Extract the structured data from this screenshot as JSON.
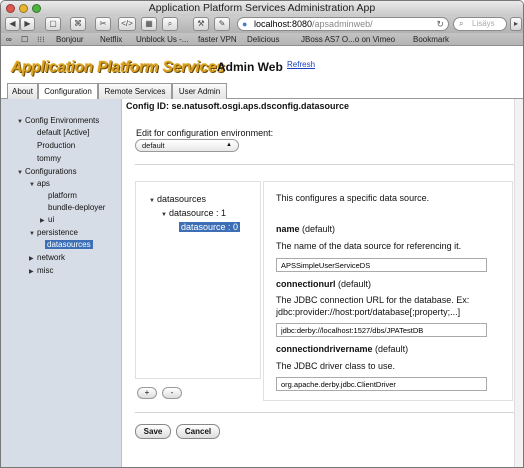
{
  "window": {
    "title": "Application Platform Services Administration App"
  },
  "toolbar": {
    "url_host": "localhost:8080",
    "url_path": "/apsadminweb/",
    "search_placeholder": "Lisäys"
  },
  "bookmarks": [
    "Bonjour",
    "Netflix",
    "Unblock Us -...",
    "faster VPN",
    "Delicious",
    "JBoss AS7 O...o on Vimeo",
    "Bookmark"
  ],
  "banner": {
    "logo": "Application Platform Services",
    "title": "Admin Web",
    "refresh": "Refresh"
  },
  "tabs": [
    "About",
    "Configuration",
    "Remote Services",
    "User Admin"
  ],
  "sidebar": {
    "config_env": "Config Environments",
    "env_default": "default [Active]",
    "env_production": "Production",
    "env_tommy": "tommy",
    "configurations": "Configurations",
    "aps": "aps",
    "platform": "platform",
    "bundle_deployer": "bundle-deployer",
    "ui": "ui",
    "persistence": "persistence",
    "datasources": "datasources",
    "network": "network",
    "misc": "misc"
  },
  "main": {
    "config_id": "Config ID: se.natusoft.osgi.aps.dsconfig.datasource",
    "edit_label": "Edit for configuration environment:",
    "env_select": "default",
    "tree": {
      "root": "datasources",
      "child": "datasource : 1",
      "leaf": "datasource : 0"
    },
    "desc": "This configures a specific data source.",
    "name_label": "name",
    "name_default": "(default)",
    "name_desc": "The name of the data source for referencing it.",
    "name_value": "APSSimpleUserServiceDS",
    "url_label": "connectionurl",
    "url_default": "(default)",
    "url_desc1": "The JDBC connection URL for the database. Ex:",
    "url_desc2": "jdbc:provider://host:port/database[;property;...]",
    "url_value": "jdbc:derby://localhost:1527/dbs/JPATestDB",
    "driver_label": "connectiondrivername",
    "driver_default": "(default)",
    "driver_desc": "The JDBC driver class to use.",
    "driver_value": "org.apache.derby.jdbc.ClientDriver",
    "add_label": "+",
    "remove_label": "-",
    "save_label": "Save",
    "cancel_label": "Cancel"
  }
}
